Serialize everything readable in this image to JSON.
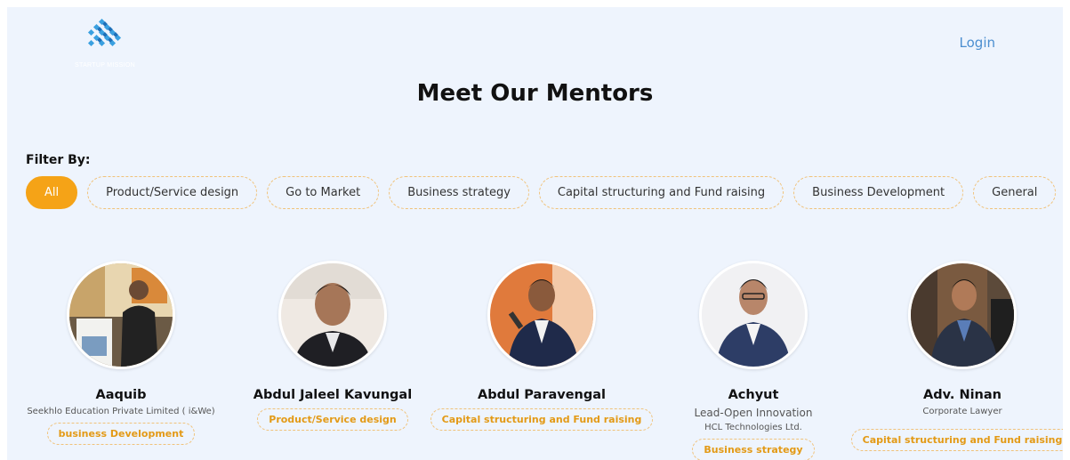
{
  "header": {
    "logo_text": "STARTUP MISSION",
    "login_label": "Login"
  },
  "page_title": "Meet Our Mentors",
  "filter": {
    "label": "Filter By:",
    "options": [
      {
        "label": "All",
        "active": true
      },
      {
        "label": "Product/Service design",
        "active": false
      },
      {
        "label": "Go to Market",
        "active": false
      },
      {
        "label": "Business strategy",
        "active": false
      },
      {
        "label": "Capital structuring and Fund raising",
        "active": false
      },
      {
        "label": "Business Development",
        "active": false
      },
      {
        "label": "General",
        "active": false
      }
    ]
  },
  "mentors": [
    {
      "name": "Aaquib",
      "line1": "Seekhlo Education Private Limited ( i&We)",
      "line2": "",
      "tag": "business Development"
    },
    {
      "name": "Abdul Jaleel Kavungal",
      "line1": "",
      "line2": "",
      "tag": "Product/Service design"
    },
    {
      "name": "Abdul Paravengal",
      "line1": "",
      "line2": "",
      "tag": "Capital structuring and Fund raising"
    },
    {
      "name": "Achyut",
      "line1": "Lead-Open Innovation",
      "line2": "HCL Technologies Ltd.",
      "tag": "Business strategy"
    },
    {
      "name": "Adv. Ninan",
      "line1": "Corporate Lawyer",
      "line2": "",
      "tag": "Capital structuring and Fund raising"
    }
  ],
  "colors": {
    "accent": "#f5a317",
    "tag_text": "#e39a16",
    "link": "#4b8ed0",
    "background": "#eef4fd"
  }
}
